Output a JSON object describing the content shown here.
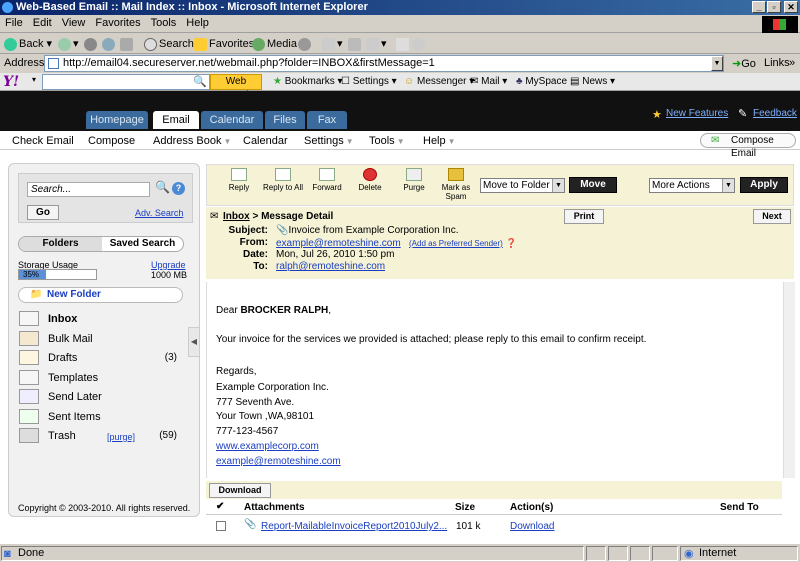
{
  "window": {
    "title": "Web-Based Email :: Mail Index :: Inbox - Microsoft Internet Explorer"
  },
  "menu": [
    "File",
    "Edit",
    "View",
    "Favorites",
    "Tools",
    "Help"
  ],
  "toolbar": {
    "back": "Back",
    "search": "Search",
    "favorites": "Favorites",
    "media": "Media"
  },
  "address": {
    "label": "Address",
    "url": "http://email04.secureserver.net/webmail.php?folder=INBOX&firstMessage=1",
    "go": "Go",
    "links": "Links"
  },
  "yahoo": {
    "logo": "Y!",
    "web_search": "Web Search",
    "bookmarks": "Bookmarks",
    "settings": "Settings",
    "messenger": "Messenger",
    "mail": "Mail",
    "myspace": "MySpace",
    "news": "News"
  },
  "app_tabs": [
    "Homepage",
    "Email",
    "Calendar",
    "Files",
    "Fax"
  ],
  "header_links": {
    "new_features": "New Features",
    "feedback": "Feedback"
  },
  "subnav": {
    "items": [
      "Check Email",
      "Compose",
      "Address Book",
      "Calendar",
      "Settings",
      "Tools",
      "Help"
    ],
    "compose_email": "Compose Email"
  },
  "sidebar": {
    "search_placeholder": "Search...",
    "go": "Go",
    "adv_search": "Adv. Search",
    "tab_folders": "Folders",
    "tab_saved": "Saved Search",
    "storage_label": "Storage Usage",
    "upgrade": "Upgrade",
    "storage_pct": "35%",
    "storage_fraction": 0.35,
    "storage_total": "1000 MB",
    "new_folder": "New Folder",
    "folders": [
      {
        "name": "Inbox",
        "count": "",
        "extra": ""
      },
      {
        "name": "Bulk Mail",
        "count": "",
        "extra": ""
      },
      {
        "name": "Drafts",
        "count": "(3)",
        "extra": ""
      },
      {
        "name": "Templates",
        "count": "",
        "extra": ""
      },
      {
        "name": "Send Later",
        "count": "",
        "extra": ""
      },
      {
        "name": "Sent Items",
        "count": "",
        "extra": ""
      },
      {
        "name": "Trash",
        "count": "(59)",
        "extra": "[purge]"
      }
    ],
    "copyright": "Copyright © 2003-2010. All rights reserved."
  },
  "actions": {
    "reply": "Reply",
    "reply_all": "Reply to All",
    "forward": "Forward",
    "delete": "Delete",
    "purge": "Purge",
    "spam": "Mark as Spam",
    "move_to_folder": "Move to Folder",
    "move": "Move",
    "more_actions": "More Actions",
    "apply": "Apply"
  },
  "message": {
    "breadcrumb_inbox": "Inbox",
    "breadcrumb_rest": " > Message Detail",
    "print": "Print",
    "next": "Next",
    "subject_label": "Subject:",
    "subject": "Invoice from Example Corporation Inc.",
    "from_label": "From:",
    "from": "example@remoteshine.com",
    "add_preferred": "(Add as Preferred Sender)",
    "date_label": "Date:",
    "date": "Mon, Jul 26, 2010 1:50 pm",
    "to_label": "To:",
    "to": "ralph@remoteshine.com",
    "greeting_prefix": "Dear ",
    "greeting_name": "BROCKER RALPH",
    "greeting_suffix": ",",
    "body": "Your invoice for the services we provided is attached; please reply to this email to confirm receipt.",
    "regards": "Regards,",
    "sig": [
      "Example Corporation Inc.",
      "777 Seventh Ave.",
      "Your Town ,WA,98101",
      "777-123-4567"
    ],
    "sig_web": "www.examplecorp.com",
    "sig_email": "example@remoteshine.com"
  },
  "attachments": {
    "download_btn": "Download",
    "col_attachments": "Attachments",
    "col_size": "Size",
    "col_actions": "Action(s)",
    "col_sendto": "Send To",
    "file": "Report-MailableInvoiceReport2010July2...",
    "size": "101 k",
    "download_link": "Download"
  },
  "status": {
    "done": "Done",
    "zone": "Internet"
  }
}
